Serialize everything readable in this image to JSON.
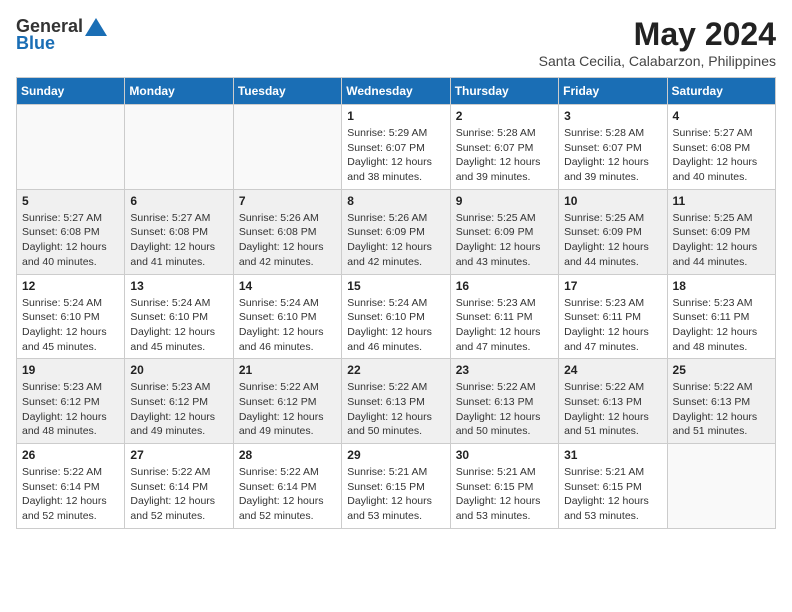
{
  "header": {
    "logo_general": "General",
    "logo_blue": "Blue",
    "title": "May 2024",
    "location": "Santa Cecilia, Calabarzon, Philippines"
  },
  "weekdays": [
    "Sunday",
    "Monday",
    "Tuesday",
    "Wednesday",
    "Thursday",
    "Friday",
    "Saturday"
  ],
  "weeks": [
    [
      {
        "day": "",
        "info": ""
      },
      {
        "day": "",
        "info": ""
      },
      {
        "day": "",
        "info": ""
      },
      {
        "day": "1",
        "info": "Sunrise: 5:29 AM\nSunset: 6:07 PM\nDaylight: 12 hours\nand 38 minutes."
      },
      {
        "day": "2",
        "info": "Sunrise: 5:28 AM\nSunset: 6:07 PM\nDaylight: 12 hours\nand 39 minutes."
      },
      {
        "day": "3",
        "info": "Sunrise: 5:28 AM\nSunset: 6:07 PM\nDaylight: 12 hours\nand 39 minutes."
      },
      {
        "day": "4",
        "info": "Sunrise: 5:27 AM\nSunset: 6:08 PM\nDaylight: 12 hours\nand 40 minutes."
      }
    ],
    [
      {
        "day": "5",
        "info": "Sunrise: 5:27 AM\nSunset: 6:08 PM\nDaylight: 12 hours\nand 40 minutes."
      },
      {
        "day": "6",
        "info": "Sunrise: 5:27 AM\nSunset: 6:08 PM\nDaylight: 12 hours\nand 41 minutes."
      },
      {
        "day": "7",
        "info": "Sunrise: 5:26 AM\nSunset: 6:08 PM\nDaylight: 12 hours\nand 42 minutes."
      },
      {
        "day": "8",
        "info": "Sunrise: 5:26 AM\nSunset: 6:09 PM\nDaylight: 12 hours\nand 42 minutes."
      },
      {
        "day": "9",
        "info": "Sunrise: 5:25 AM\nSunset: 6:09 PM\nDaylight: 12 hours\nand 43 minutes."
      },
      {
        "day": "10",
        "info": "Sunrise: 5:25 AM\nSunset: 6:09 PM\nDaylight: 12 hours\nand 44 minutes."
      },
      {
        "day": "11",
        "info": "Sunrise: 5:25 AM\nSunset: 6:09 PM\nDaylight: 12 hours\nand 44 minutes."
      }
    ],
    [
      {
        "day": "12",
        "info": "Sunrise: 5:24 AM\nSunset: 6:10 PM\nDaylight: 12 hours\nand 45 minutes."
      },
      {
        "day": "13",
        "info": "Sunrise: 5:24 AM\nSunset: 6:10 PM\nDaylight: 12 hours\nand 45 minutes."
      },
      {
        "day": "14",
        "info": "Sunrise: 5:24 AM\nSunset: 6:10 PM\nDaylight: 12 hours\nand 46 minutes."
      },
      {
        "day": "15",
        "info": "Sunrise: 5:24 AM\nSunset: 6:10 PM\nDaylight: 12 hours\nand 46 minutes."
      },
      {
        "day": "16",
        "info": "Sunrise: 5:23 AM\nSunset: 6:11 PM\nDaylight: 12 hours\nand 47 minutes."
      },
      {
        "day": "17",
        "info": "Sunrise: 5:23 AM\nSunset: 6:11 PM\nDaylight: 12 hours\nand 47 minutes."
      },
      {
        "day": "18",
        "info": "Sunrise: 5:23 AM\nSunset: 6:11 PM\nDaylight: 12 hours\nand 48 minutes."
      }
    ],
    [
      {
        "day": "19",
        "info": "Sunrise: 5:23 AM\nSunset: 6:12 PM\nDaylight: 12 hours\nand 48 minutes."
      },
      {
        "day": "20",
        "info": "Sunrise: 5:23 AM\nSunset: 6:12 PM\nDaylight: 12 hours\nand 49 minutes."
      },
      {
        "day": "21",
        "info": "Sunrise: 5:22 AM\nSunset: 6:12 PM\nDaylight: 12 hours\nand 49 minutes."
      },
      {
        "day": "22",
        "info": "Sunrise: 5:22 AM\nSunset: 6:13 PM\nDaylight: 12 hours\nand 50 minutes."
      },
      {
        "day": "23",
        "info": "Sunrise: 5:22 AM\nSunset: 6:13 PM\nDaylight: 12 hours\nand 50 minutes."
      },
      {
        "day": "24",
        "info": "Sunrise: 5:22 AM\nSunset: 6:13 PM\nDaylight: 12 hours\nand 51 minutes."
      },
      {
        "day": "25",
        "info": "Sunrise: 5:22 AM\nSunset: 6:13 PM\nDaylight: 12 hours\nand 51 minutes."
      }
    ],
    [
      {
        "day": "26",
        "info": "Sunrise: 5:22 AM\nSunset: 6:14 PM\nDaylight: 12 hours\nand 52 minutes."
      },
      {
        "day": "27",
        "info": "Sunrise: 5:22 AM\nSunset: 6:14 PM\nDaylight: 12 hours\nand 52 minutes."
      },
      {
        "day": "28",
        "info": "Sunrise: 5:22 AM\nSunset: 6:14 PM\nDaylight: 12 hours\nand 52 minutes."
      },
      {
        "day": "29",
        "info": "Sunrise: 5:21 AM\nSunset: 6:15 PM\nDaylight: 12 hours\nand 53 minutes."
      },
      {
        "day": "30",
        "info": "Sunrise: 5:21 AM\nSunset: 6:15 PM\nDaylight: 12 hours\nand 53 minutes."
      },
      {
        "day": "31",
        "info": "Sunrise: 5:21 AM\nSunset: 6:15 PM\nDaylight: 12 hours\nand 53 minutes."
      },
      {
        "day": "",
        "info": ""
      }
    ]
  ]
}
